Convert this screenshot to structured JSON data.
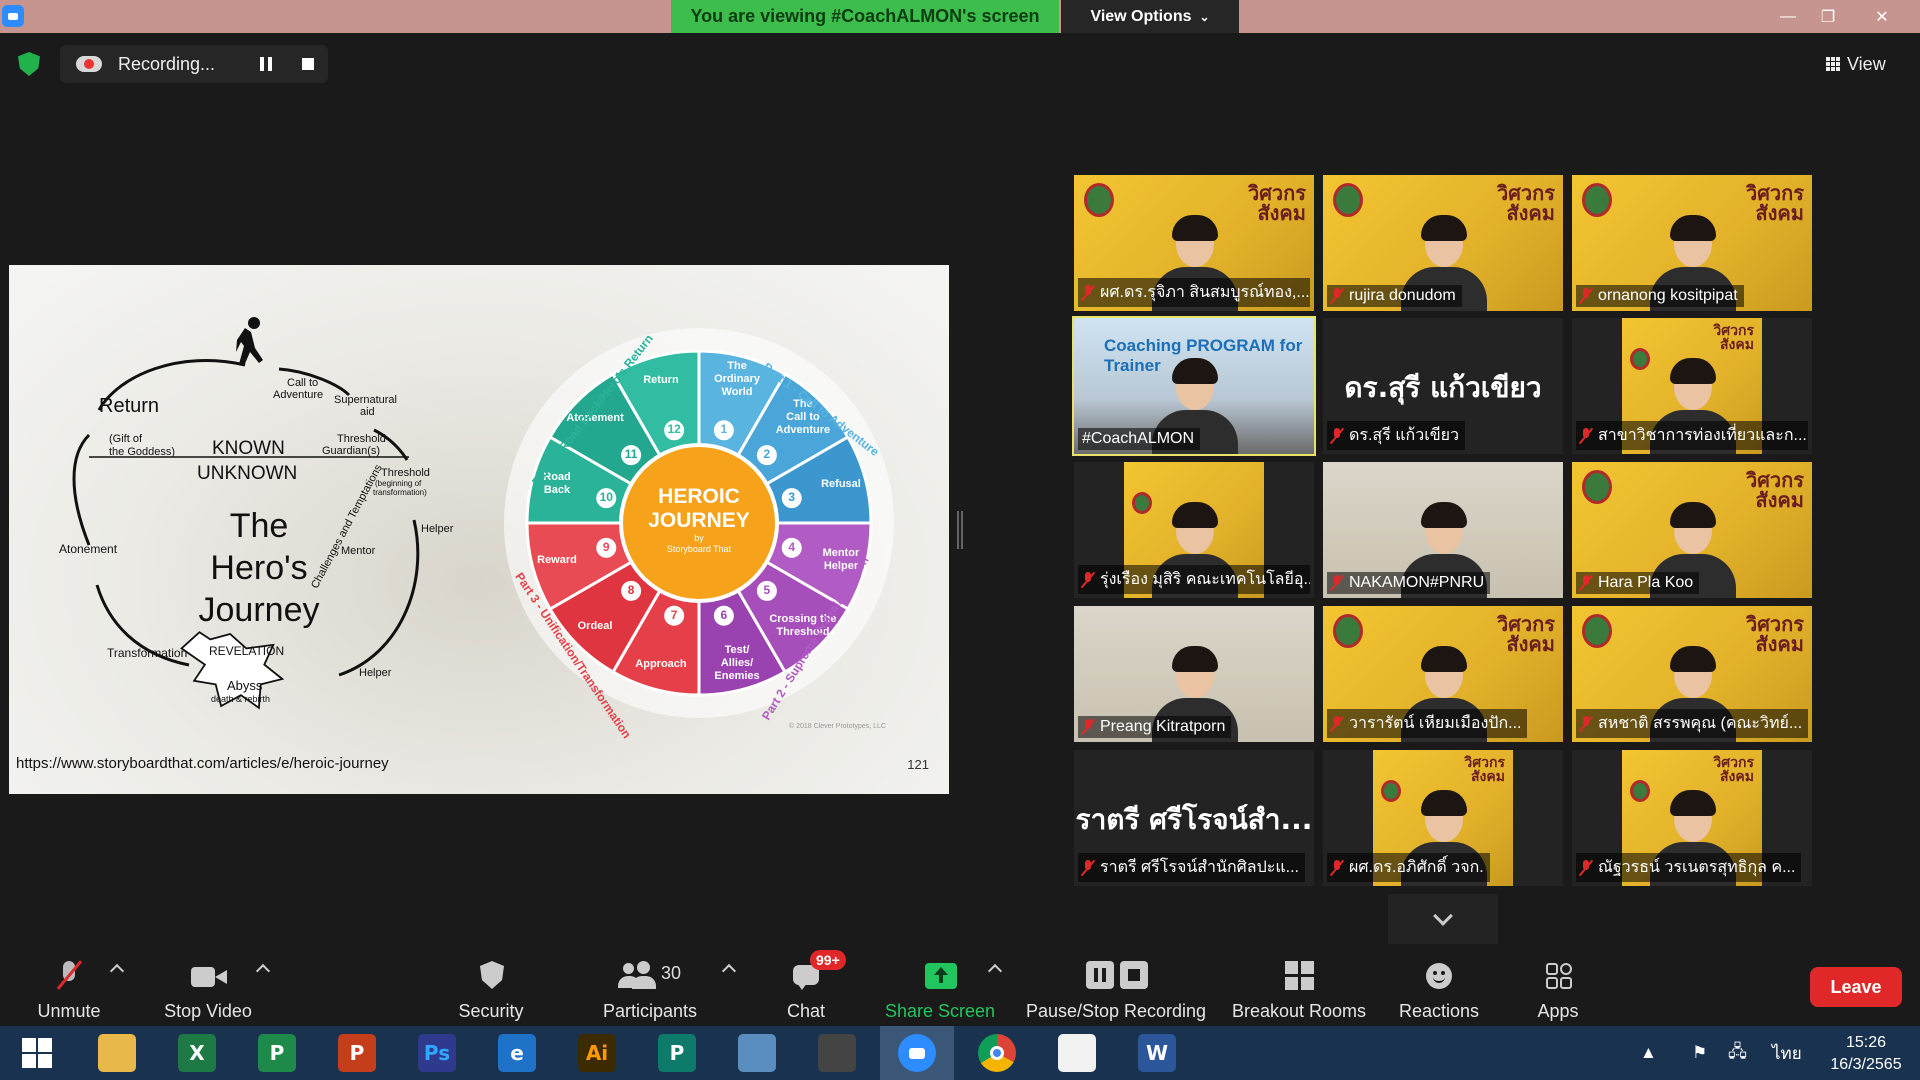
{
  "titlebar": {
    "viewing_banner": "You are viewing #CoachALMON's screen",
    "view_options": "View Options",
    "minimize": "—",
    "restore": "❐",
    "close": "✕"
  },
  "recording": {
    "status": "Recording...",
    "view_label": "View"
  },
  "slide": {
    "url": "https://www.storyboardthat.com/articles/e/heroic-journey",
    "page_number": "121",
    "left_diagram": {
      "title_lines": [
        "The",
        "Hero's",
        "Journey"
      ],
      "known": "KNOWN",
      "unknown": "UNKNOWN",
      "labels": {
        "return": "Return",
        "gift_1": "(Gift of",
        "gift_2": "the Goddess)",
        "call_1": "Call to",
        "call_2": "Adventure",
        "supernatural_1": "Supernatural",
        "supernatural_2": "aid",
        "guardian_1": "Threshold",
        "guardian_2": "Guardian(s)",
        "threshold": "Threshold",
        "threshold_sub_1": "(beginning of",
        "threshold_sub_2": "transformation)",
        "helper_1": "Helper",
        "mentor": "Mentor",
        "atonement": "Atonement",
        "challenges": "Challenges and Temptations",
        "helper_2": "Helper",
        "transformation": "Transformation",
        "revelation": "REVELATION",
        "abyss": "Abyss",
        "abyss_sub": "death & rebirth"
      }
    },
    "wheel": {
      "center_1": "HEROIC",
      "center_2": "JOURNEY",
      "center_3": "by",
      "center_4": "Storyboard That",
      "part1": "Part 1 - Call to Adventure",
      "part2": "Part 2 - Supreme Ordeal/Initiation",
      "part3": "Part 3 - Unification/Transformation",
      "part4": "Part 4 - Road Back/Hero's Return",
      "copyright": "© 2018 Clever Prototypes, LLC",
      "segments": [
        {
          "num": "1",
          "lines": [
            "The",
            "Ordinary",
            "World"
          ],
          "color": "#5ab4e0"
        },
        {
          "num": "2",
          "lines": [
            "The",
            "Call to",
            "Adventure"
          ],
          "color": "#4aa6d8"
        },
        {
          "num": "3",
          "lines": [
            "Refusal"
          ],
          "color": "#3c97cf"
        },
        {
          "num": "4",
          "lines": [
            "Mentor",
            "Helper"
          ],
          "color": "#b15cc4"
        },
        {
          "num": "5",
          "lines": [
            "Crossing the",
            "Threshold"
          ],
          "color": "#a64fba"
        },
        {
          "num": "6",
          "lines": [
            "Test/",
            "Allies/",
            "Enemies"
          ],
          "color": "#9a43b0"
        },
        {
          "num": "7",
          "lines": [
            "Approach"
          ],
          "color": "#e5404a"
        },
        {
          "num": "8",
          "lines": [
            "Ordeal"
          ],
          "color": "#de3540"
        },
        {
          "num": "9",
          "lines": [
            "Reward"
          ],
          "color": "#e94b55"
        },
        {
          "num": "10",
          "lines": [
            "Road",
            "Back"
          ],
          "color": "#2bb39a"
        },
        {
          "num": "11",
          "lines": [
            "Atonement"
          ],
          "color": "#23a88f"
        },
        {
          "num": "12",
          "lines": [
            "Return"
          ],
          "color": "#32bca2"
        }
      ]
    }
  },
  "participants": [
    {
      "name": "ผศ.ดร.รุจิภา สินสมบูรณ์ทอง,...",
      "type": "poster",
      "brand": "วิศวกร\nสังคม"
    },
    {
      "name": "rujira donudom",
      "type": "poster",
      "brand": "วิศวกร\nสังคม"
    },
    {
      "name": "ornanong kositpipat",
      "type": "poster",
      "brand": "วิศวกร\nสังคม"
    },
    {
      "name": "#CoachALMON",
      "type": "coach",
      "banner": "Coaching PROGRAM for Trainer"
    },
    {
      "name": "ดร.สุรี  แก้วเขียว",
      "type": "name",
      "big": "ดร.สุรี  แก้วเขียว"
    },
    {
      "name": "สาขาวิชาการท่องเที่ยวและก...",
      "type": "narrow",
      "brand": "วิศวกร\nสังคม"
    },
    {
      "name": "รุ่งเรือง มุสิริ คณะเทคโนโลยีอุ...",
      "type": "narrow",
      "brand": ""
    },
    {
      "name": "NAKAMON#PNRU",
      "type": "office"
    },
    {
      "name": "Hara Pla Koo",
      "type": "poster",
      "brand": "วิศวกร\nสังคม"
    },
    {
      "name": "Preang Kitratporn",
      "type": "office"
    },
    {
      "name": "วารารัตน์ เหียมเมืองปัก...",
      "type": "poster",
      "brand": "วิศวกร\nสังคม"
    },
    {
      "name": "สหชาติ สรรพคุณ (คณะวิทย์...",
      "type": "poster",
      "brand": "วิศวกร\nสังคม"
    },
    {
      "name": "ราตรี   ศรีโรจน์สำนักศิลปะแ...",
      "type": "name",
      "big": "ราตรี   ศรีโรจน์สำ..."
    },
    {
      "name": "ผศ.ดร.อภิศักดิ์ วจก.",
      "type": "narrow",
      "brand": "วิศวกร\nสังคม"
    },
    {
      "name": "ณัฐวรธน์ วรเนตรสุทธิกุล ค...",
      "type": "narrow",
      "brand": "วิศวกร\nสังคม"
    }
  ],
  "toolbar": {
    "unmute": "Unmute",
    "stop_video": "Stop Video",
    "security": "Security",
    "participants": "Participants",
    "participant_count": "30",
    "chat": "Chat",
    "chat_badge": "99+",
    "share_screen": "Share Screen",
    "pause_stop_recording": "Pause/Stop Recording",
    "breakout_rooms": "Breakout Rooms",
    "reactions": "Reactions",
    "apps": "Apps",
    "leave": "Leave"
  },
  "taskbar": {
    "apps": [
      {
        "name": "windows-start",
        "label": ""
      },
      {
        "name": "file-explorer",
        "label": ""
      },
      {
        "name": "excel",
        "label": "X"
      },
      {
        "name": "publisher-store",
        "label": "P"
      },
      {
        "name": "powerpoint",
        "label": "P"
      },
      {
        "name": "photoshop",
        "label": "Ps"
      },
      {
        "name": "internet-explorer",
        "label": "e"
      },
      {
        "name": "illustrator",
        "label": "Ai"
      },
      {
        "name": "publisher",
        "label": "P"
      },
      {
        "name": "pen-tool",
        "label": ""
      },
      {
        "name": "photoscape",
        "label": ""
      },
      {
        "name": "zoom",
        "label": ""
      },
      {
        "name": "chrome",
        "label": ""
      },
      {
        "name": "photos",
        "label": ""
      },
      {
        "name": "word",
        "label": "W"
      }
    ],
    "language": "ไทย",
    "time": "15:26",
    "date": "16/3/2565"
  },
  "colors": {
    "banner_green": "#3dbd4c",
    "leave_red": "#e02828",
    "share_green": "#22c55e",
    "poster_yellow": "#f3c531",
    "taskbar_blue": "#18324f"
  }
}
